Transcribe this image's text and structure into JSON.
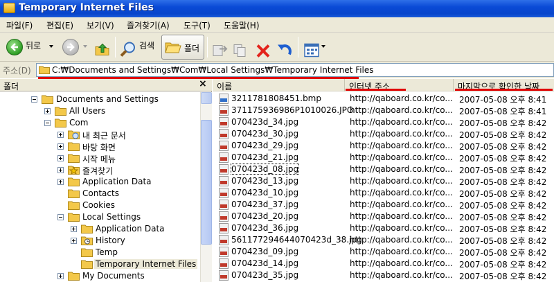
{
  "window": {
    "title": "Temporary Internet Files"
  },
  "menu": [
    "파일(F)",
    "편집(E)",
    "보기(V)",
    "즐겨찾기(A)",
    "도구(T)",
    "도움말(H)"
  ],
  "toolbar": {
    "back_label": "뒤로",
    "search_label": "검색",
    "folders_label": "폴더"
  },
  "address": {
    "label": "주소(D)",
    "value": "C:₩Documents and Settings₩Com₩Local Settings₩Temporary Internet Files"
  },
  "folder_pane": {
    "title": "폴더",
    "close": "×",
    "items": [
      {
        "label": "Documents and Settings",
        "expander": "minus",
        "icon": "folder-icon"
      },
      {
        "label": "All Users",
        "expander": "plus",
        "icon": "folder-icon"
      },
      {
        "label": "Com",
        "expander": "minus",
        "icon": "folder-icon"
      },
      {
        "label": "내 최근 문서",
        "expander": "plus",
        "icon": "recent-docs-icon"
      },
      {
        "label": "바탕 화면",
        "expander": "plus",
        "icon": "folder-icon"
      },
      {
        "label": "시작 메뉴",
        "expander": "plus",
        "icon": "folder-icon"
      },
      {
        "label": "즐겨찾기",
        "expander": "plus",
        "icon": "favorites-star-icon"
      },
      {
        "label": "Application Data",
        "expander": "plus",
        "icon": "folder-icon"
      },
      {
        "label": "Contacts",
        "expander": "none",
        "icon": "folder-icon"
      },
      {
        "label": "Cookies",
        "expander": "none",
        "icon": "folder-icon"
      },
      {
        "label": "Local Settings",
        "expander": "minus",
        "icon": "folder-icon"
      },
      {
        "label": "Application Data",
        "expander": "plus",
        "icon": "folder-icon"
      },
      {
        "label": "History",
        "expander": "plus",
        "icon": "history-folder-icon"
      },
      {
        "label": "Temp",
        "expander": "none",
        "icon": "folder-icon"
      },
      {
        "label": "Temporary Internet Files",
        "expander": "none",
        "icon": "folder-icon",
        "selected": true
      },
      {
        "label": "My Documents",
        "expander": "plus",
        "icon": "folder-icon"
      }
    ]
  },
  "file_list": {
    "columns": [
      "이름",
      "인터넷 주소",
      "마지막으로 확인한 날짜"
    ],
    "rows": [
      {
        "name": "3211781808451.bmp",
        "url": "http://qaboard.co.kr/co...",
        "date": "2007-05-08 오후 8:41",
        "type": "bmp"
      },
      {
        "name": "371175936986P1010026.JPG",
        "url": "http://qaboard.co.kr/co...",
        "date": "2007-05-08 오후 8:41",
        "type": "jpg"
      },
      {
        "name": "070423d_34.jpg",
        "url": "http://qaboard.co.kr/co...",
        "date": "2007-05-08 오후 8:42",
        "type": "jpg"
      },
      {
        "name": "070423d_30.jpg",
        "url": "http://qaboard.co.kr/co...",
        "date": "2007-05-08 오후 8:42",
        "type": "jpg"
      },
      {
        "name": "070423d_29.jpg",
        "url": "http://qaboard.co.kr/co...",
        "date": "2007-05-08 오후 8:42",
        "type": "jpg"
      },
      {
        "name": "070423d_21.jpg",
        "url": "http://qaboard.co.kr/co...",
        "date": "2007-05-08 오후 8:42",
        "type": "jpg"
      },
      {
        "name": "070423d_08.jpg",
        "url": "http://qaboard.co.kr/co...",
        "date": "2007-05-08 오후 8:42",
        "type": "jpg",
        "focused": true
      },
      {
        "name": "070423d_13.jpg",
        "url": "http://qaboard.co.kr/co...",
        "date": "2007-05-08 오후 8:42",
        "type": "jpg"
      },
      {
        "name": "070423d_10.jpg",
        "url": "http://qaboard.co.kr/co...",
        "date": "2007-05-08 오후 8:42",
        "type": "jpg"
      },
      {
        "name": "070423d_37.jpg",
        "url": "http://qaboard.co.kr/co...",
        "date": "2007-05-08 오후 8:42",
        "type": "jpg"
      },
      {
        "name": "070423d_20.jpg",
        "url": "http://qaboard.co.kr/co...",
        "date": "2007-05-08 오후 8:42",
        "type": "jpg"
      },
      {
        "name": "070423d_36.jpg",
        "url": "http://qaboard.co.kr/co...",
        "date": "2007-05-08 오후 8:42",
        "type": "jpg"
      },
      {
        "name": "561177294644070423d_38.jpg",
        "url": "http://qaboard.co.kr/co...",
        "date": "2007-05-08 오후 8:42",
        "type": "jpg"
      },
      {
        "name": "070423d_09.jpg",
        "url": "http://qaboard.co.kr/co...",
        "date": "2007-05-08 오후 8:42",
        "type": "jpg"
      },
      {
        "name": "070423d_14.jpg",
        "url": "http://qaboard.co.kr/co...",
        "date": "2007-05-08 오후 8:42",
        "type": "jpg"
      },
      {
        "name": "070423d_35.jpg",
        "url": "http://qaboard.co.kr/co...",
        "date": "2007-05-08 오후 8:42",
        "type": "jpg"
      }
    ]
  },
  "colors": {
    "titlebar": "#0a4ad6",
    "annotation_underline": "#e00000",
    "chrome": "#ece9d8"
  }
}
